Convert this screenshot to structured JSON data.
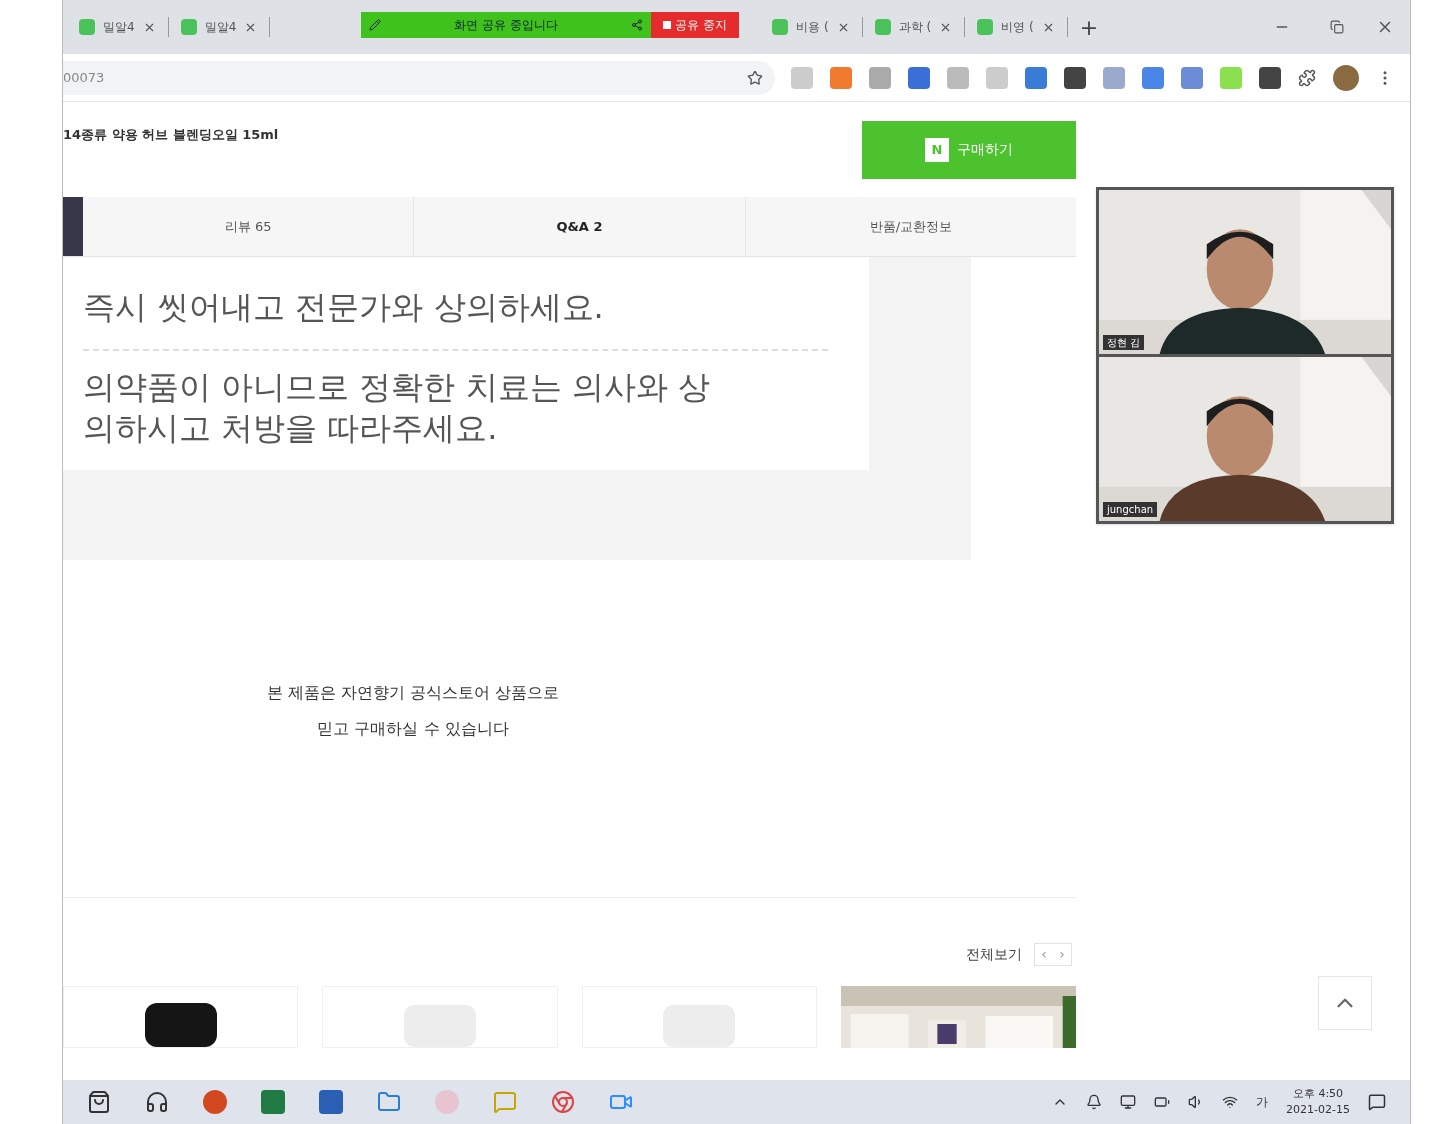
{
  "browser": {
    "tabs": [
      {
        "title": "밀알4",
        "selected": false
      },
      {
        "title": "밀알4",
        "selected": false
      },
      {
        "title": "비용 (",
        "selected": false
      },
      {
        "title": "과학 (",
        "selected": false
      },
      {
        "title": "비영 (",
        "selected": false
      }
    ],
    "new_tab": "+",
    "address": "00073"
  },
  "share_banner": {
    "message": "화면 공유 중입니다",
    "stop": "공유 중지"
  },
  "product": {
    "title": "14종류 약용 허브 블렌딩오일 15ml",
    "buy_badge": "N",
    "buy": "구매하기",
    "tabs": [
      {
        "label": "리뷰 65",
        "selected": false
      },
      {
        "label": "Q&A 2",
        "selected": true
      },
      {
        "label": "반품/교환정보",
        "selected": false
      }
    ],
    "notices": [
      "즉시 씻어내고 전문가와 상의하세요.",
      "의약품이 아니므로 정확한 치료는 의사와 상의하시고 처방을 따라주세요."
    ],
    "store_note": [
      "본 제품은 자연향기 공식스토어 상품으로",
      "믿고 구매하실 수 있습니다"
    ],
    "related": {
      "view_all": "전체보기",
      "prev": "‹",
      "next": "›",
      "items": [
        {
          "kind": "jar"
        },
        {
          "kind": "bottle"
        },
        {
          "kind": "bottle"
        },
        {
          "kind": "picture"
        }
      ]
    }
  },
  "video": [
    {
      "name": "정현 김"
    },
    {
      "name": "jungchan"
    }
  ],
  "taskbar": {
    "ime": "가",
    "time": "오후 4:50",
    "date": "2021-02-15"
  }
}
